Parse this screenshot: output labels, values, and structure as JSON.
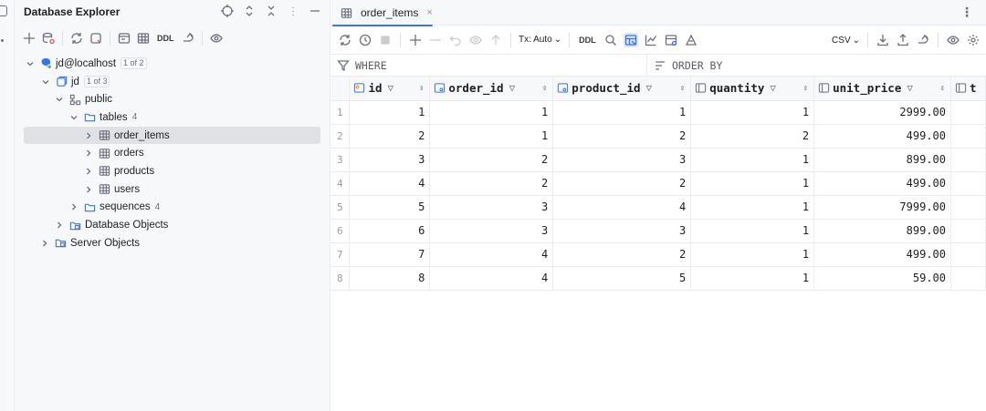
{
  "explorer": {
    "title": "Database Explorer",
    "toolbar": {
      "ddl_label": "DDL"
    },
    "tree": {
      "connection": {
        "label": "jd@localhost",
        "badge": "1 of 2"
      },
      "database": {
        "label": "jd",
        "badge": "1 of 3"
      },
      "schema": {
        "label": "public"
      },
      "tables": {
        "label": "tables",
        "count": "4"
      },
      "table_items": [
        "order_items",
        "orders",
        "products",
        "users"
      ],
      "sequences": {
        "label": "sequences",
        "count": "4"
      },
      "db_objects": {
        "label": "Database Objects"
      },
      "server_objects": {
        "label": "Server Objects"
      }
    }
  },
  "editor": {
    "tab": {
      "label": "order_items",
      "close": "×"
    },
    "kebab": "⋮",
    "toolbar": {
      "tx_label": "Tx: Auto",
      "ddl_label": "DDL",
      "export_label": "CSV"
    },
    "filter": {
      "where_label": "WHERE",
      "order_label": "ORDER BY"
    },
    "columns": [
      "id",
      "order_id",
      "product_id",
      "quantity",
      "unit_price",
      "t"
    ],
    "rows": [
      {
        "n": "1",
        "cells": [
          "1",
          "1",
          "1",
          "1",
          "2999.00"
        ]
      },
      {
        "n": "2",
        "cells": [
          "2",
          "1",
          "2",
          "2",
          "499.00"
        ]
      },
      {
        "n": "3",
        "cells": [
          "3",
          "2",
          "3",
          "1",
          "899.00"
        ]
      },
      {
        "n": "4",
        "cells": [
          "4",
          "2",
          "2",
          "1",
          "499.00"
        ]
      },
      {
        "n": "5",
        "cells": [
          "5",
          "3",
          "4",
          "1",
          "7999.00"
        ]
      },
      {
        "n": "6",
        "cells": [
          "6",
          "3",
          "3",
          "1",
          "899.00"
        ]
      },
      {
        "n": "7",
        "cells": [
          "7",
          "4",
          "2",
          "1",
          "499.00"
        ]
      },
      {
        "n": "8",
        "cells": [
          "8",
          "4",
          "5",
          "1",
          "59.00"
        ]
      }
    ]
  },
  "colors": {
    "accent": "#3574f0",
    "selected_row": "#dfe1e5",
    "panel_bg": "#f7f8fa"
  }
}
